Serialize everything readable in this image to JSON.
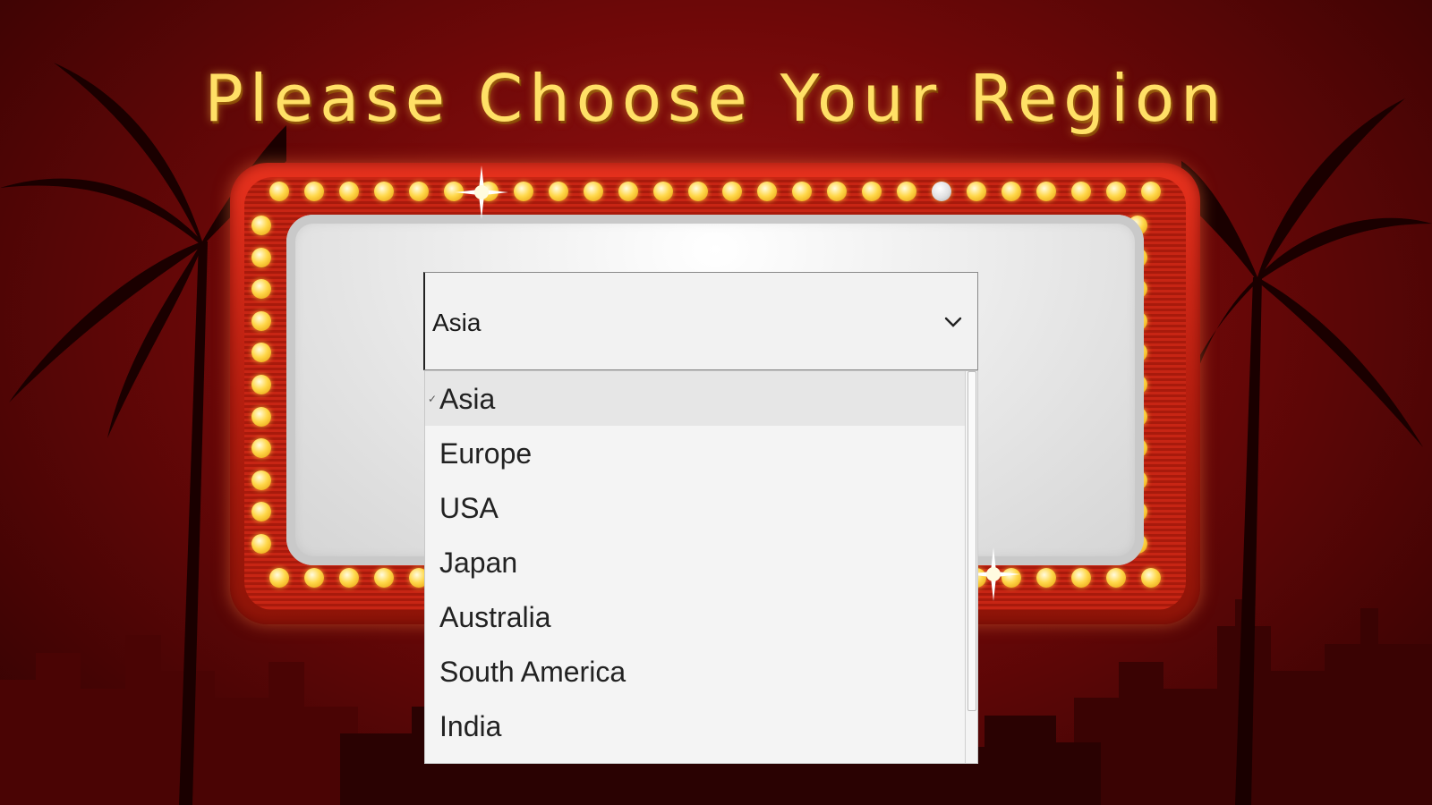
{
  "page": {
    "title": "Please Choose Your Region"
  },
  "region_select": {
    "selected_value": "Asia",
    "options": [
      {
        "label": "Asia",
        "selected": true
      },
      {
        "label": "Europe",
        "selected": false
      },
      {
        "label": "USA",
        "selected": false
      },
      {
        "label": "Japan",
        "selected": false
      },
      {
        "label": "Australia",
        "selected": false
      },
      {
        "label": "South America",
        "selected": false
      },
      {
        "label": "India",
        "selected": false
      }
    ]
  },
  "colors": {
    "background": "#7a0a0a",
    "title": "#ffe066",
    "marquee_frame": "#d02814",
    "bulb": "#ffd84a",
    "sign_panel": "#ececec"
  },
  "icons": {
    "dropdown_arrow": "chevron-down-icon",
    "selected_marker": "check-icon"
  }
}
